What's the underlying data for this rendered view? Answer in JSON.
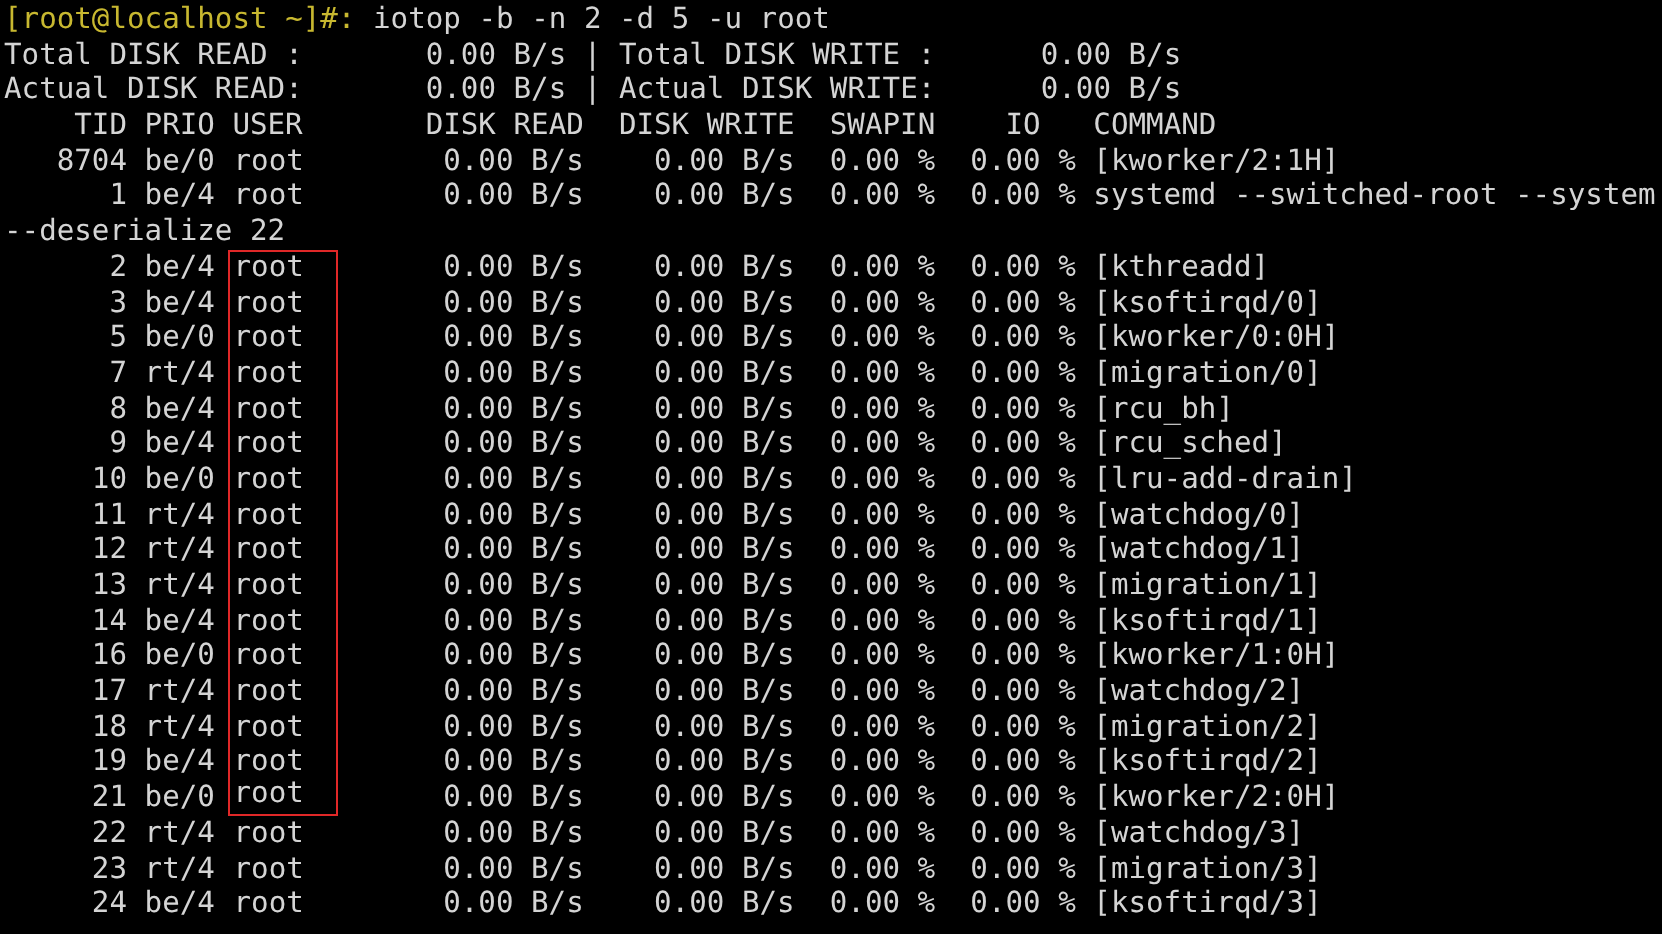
{
  "prompt": {
    "user_host": "[root@localhost ~]#:",
    "command": "iotop -b -n 2 -d 5 -u root"
  },
  "summary": [
    {
      "read_label": "Total DISK READ :",
      "read_value": "0.00 B/s",
      "separator": "|",
      "write_label": "Total DISK WRITE :",
      "write_value": "0.00 B/s"
    },
    {
      "read_label": "Actual DISK READ:",
      "read_value": "0.00 B/s",
      "separator": "|",
      "write_label": "Actual DISK WRITE:",
      "write_value": "0.00 B/s"
    }
  ],
  "columns": {
    "tid": "TID",
    "prio": "PRIO",
    "user": "USER",
    "disk_read": "DISK READ",
    "disk_write": "DISK WRITE",
    "swapin": "SWAPIN",
    "io": "IO",
    "command": "COMMAND"
  },
  "rows": [
    {
      "tid": "8704",
      "prio": "be/0",
      "user": "root",
      "disk_read": "0.00 B/s",
      "disk_write": "0.00 B/s",
      "swapin": "0.00 %",
      "io": "0.00 %",
      "command": "[kworker/2:1H]",
      "highlighted": false
    },
    {
      "tid": "1",
      "prio": "be/4",
      "user": "root",
      "disk_read": "0.00 B/s",
      "disk_write": "0.00 B/s",
      "swapin": "0.00 %",
      "io": "0.00 %",
      "command": "systemd --switched-root --system",
      "command_continued": "--deserialize 22",
      "highlighted": false
    },
    {
      "tid": "2",
      "prio": "be/4",
      "user": "root",
      "disk_read": "0.00 B/s",
      "disk_write": "0.00 B/s",
      "swapin": "0.00 %",
      "io": "0.00 %",
      "command": "[kthreadd]",
      "highlighted": true
    },
    {
      "tid": "3",
      "prio": "be/4",
      "user": "root",
      "disk_read": "0.00 B/s",
      "disk_write": "0.00 B/s",
      "swapin": "0.00 %",
      "io": "0.00 %",
      "command": "[ksoftirqd/0]",
      "highlighted": true
    },
    {
      "tid": "5",
      "prio": "be/0",
      "user": "root",
      "disk_read": "0.00 B/s",
      "disk_write": "0.00 B/s",
      "swapin": "0.00 %",
      "io": "0.00 %",
      "command": "[kworker/0:0H]",
      "highlighted": true
    },
    {
      "tid": "7",
      "prio": "rt/4",
      "user": "root",
      "disk_read": "0.00 B/s",
      "disk_write": "0.00 B/s",
      "swapin": "0.00 %",
      "io": "0.00 %",
      "command": "[migration/0]",
      "highlighted": true
    },
    {
      "tid": "8",
      "prio": "be/4",
      "user": "root",
      "disk_read": "0.00 B/s",
      "disk_write": "0.00 B/s",
      "swapin": "0.00 %",
      "io": "0.00 %",
      "command": "[rcu_bh]",
      "highlighted": true
    },
    {
      "tid": "9",
      "prio": "be/4",
      "user": "root",
      "disk_read": "0.00 B/s",
      "disk_write": "0.00 B/s",
      "swapin": "0.00 %",
      "io": "0.00 %",
      "command": "[rcu_sched]",
      "highlighted": true
    },
    {
      "tid": "10",
      "prio": "be/0",
      "user": "root",
      "disk_read": "0.00 B/s",
      "disk_write": "0.00 B/s",
      "swapin": "0.00 %",
      "io": "0.00 %",
      "command": "[lru-add-drain]",
      "highlighted": true
    },
    {
      "tid": "11",
      "prio": "rt/4",
      "user": "root",
      "disk_read": "0.00 B/s",
      "disk_write": "0.00 B/s",
      "swapin": "0.00 %",
      "io": "0.00 %",
      "command": "[watchdog/0]",
      "highlighted": true
    },
    {
      "tid": "12",
      "prio": "rt/4",
      "user": "root",
      "disk_read": "0.00 B/s",
      "disk_write": "0.00 B/s",
      "swapin": "0.00 %",
      "io": "0.00 %",
      "command": "[watchdog/1]",
      "highlighted": true
    },
    {
      "tid": "13",
      "prio": "rt/4",
      "user": "root",
      "disk_read": "0.00 B/s",
      "disk_write": "0.00 B/s",
      "swapin": "0.00 %",
      "io": "0.00 %",
      "command": "[migration/1]",
      "highlighted": true
    },
    {
      "tid": "14",
      "prio": "be/4",
      "user": "root",
      "disk_read": "0.00 B/s",
      "disk_write": "0.00 B/s",
      "swapin": "0.00 %",
      "io": "0.00 %",
      "command": "[ksoftirqd/1]",
      "highlighted": true
    },
    {
      "tid": "16",
      "prio": "be/0",
      "user": "root",
      "disk_read": "0.00 B/s",
      "disk_write": "0.00 B/s",
      "swapin": "0.00 %",
      "io": "0.00 %",
      "command": "[kworker/1:0H]",
      "highlighted": true
    },
    {
      "tid": "17",
      "prio": "rt/4",
      "user": "root",
      "disk_read": "0.00 B/s",
      "disk_write": "0.00 B/s",
      "swapin": "0.00 %",
      "io": "0.00 %",
      "command": "[watchdog/2]",
      "highlighted": true
    },
    {
      "tid": "18",
      "prio": "rt/4",
      "user": "root",
      "disk_read": "0.00 B/s",
      "disk_write": "0.00 B/s",
      "swapin": "0.00 %",
      "io": "0.00 %",
      "command": "[migration/2]",
      "highlighted": true
    },
    {
      "tid": "19",
      "prio": "be/4",
      "user": "root",
      "disk_read": "0.00 B/s",
      "disk_write": "0.00 B/s",
      "swapin": "0.00 %",
      "io": "0.00 %",
      "command": "[ksoftirqd/2]",
      "highlighted": true
    },
    {
      "tid": "21",
      "prio": "be/0",
      "user": "root",
      "disk_read": "0.00 B/s",
      "disk_write": "0.00 B/s",
      "swapin": "0.00 %",
      "io": "0.00 %",
      "command": "[kworker/2:0H]",
      "highlighted": true
    },
    {
      "tid": "22",
      "prio": "rt/4",
      "user": "root",
      "disk_read": "0.00 B/s",
      "disk_write": "0.00 B/s",
      "swapin": "0.00 %",
      "io": "0.00 %",
      "command": "[watchdog/3]",
      "highlighted": false
    },
    {
      "tid": "23",
      "prio": "rt/4",
      "user": "root",
      "disk_read": "0.00 B/s",
      "disk_write": "0.00 B/s",
      "swapin": "0.00 %",
      "io": "0.00 %",
      "command": "[migration/3]",
      "highlighted": false
    },
    {
      "tid": "24",
      "prio": "be/4",
      "user": "root",
      "disk_read": "0.00 B/s",
      "disk_write": "0.00 B/s",
      "swapin": "0.00 %",
      "io": "0.00 %",
      "command": "[ksoftirqd/3]",
      "highlighted": false
    }
  ]
}
